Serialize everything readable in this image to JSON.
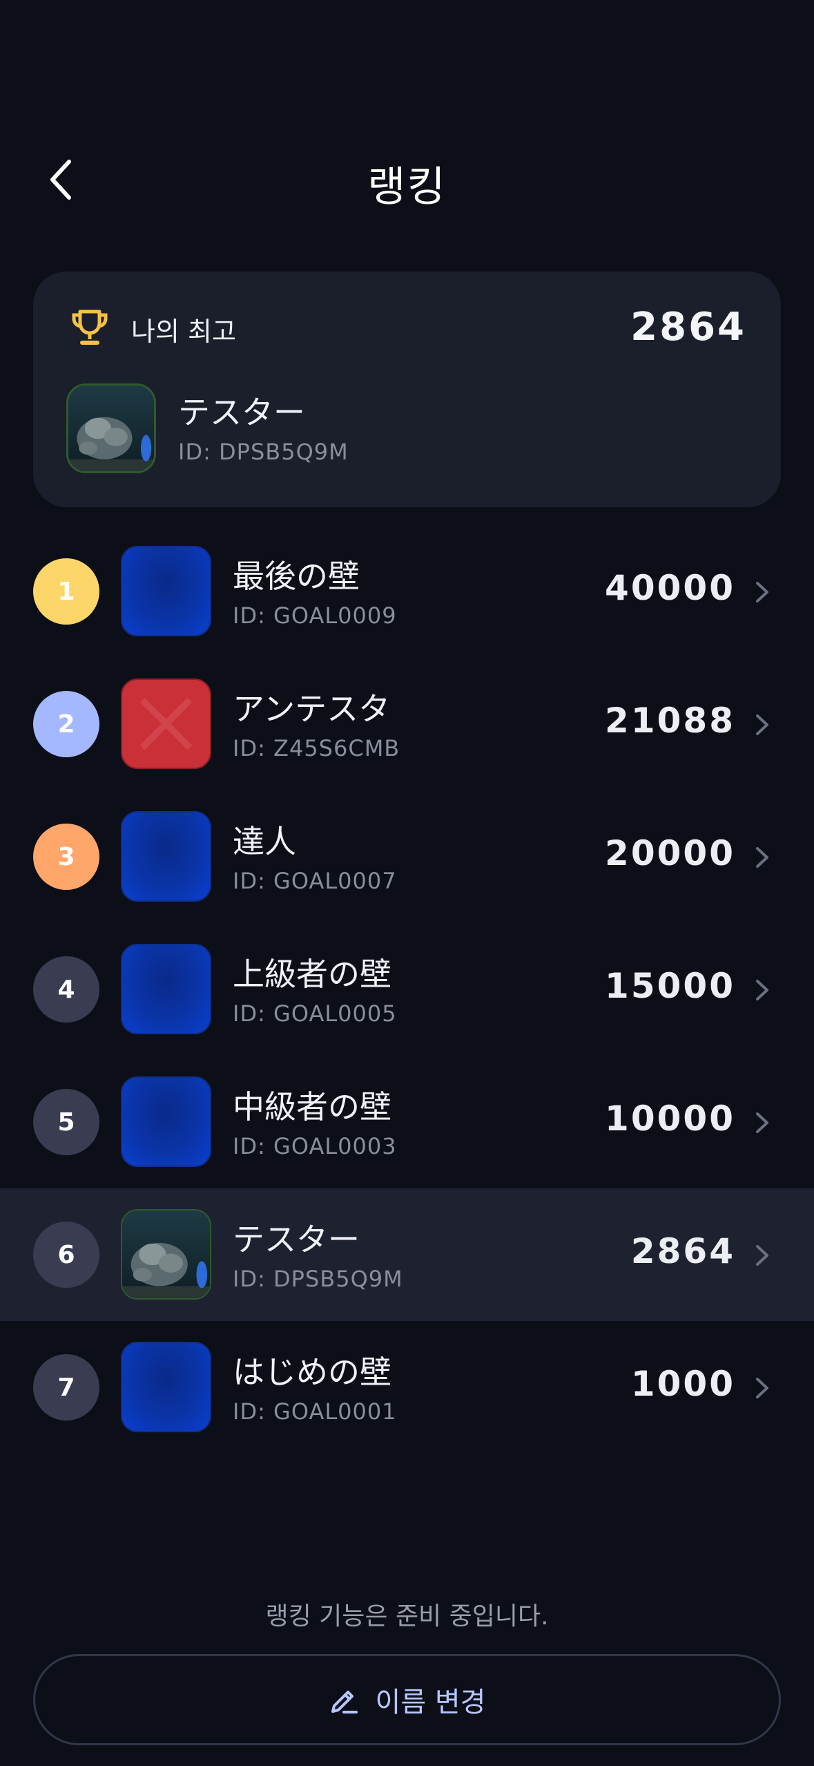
{
  "header": {
    "title": "랭킹",
    "back_icon": "chevron-left-icon"
  },
  "best": {
    "label": "나의 최고",
    "score": "2864",
    "name": "テスター",
    "id": "ID: DPSB5Q9M",
    "icon": "trophy-icon",
    "trophy_color": "#f6c246"
  },
  "rankings": [
    {
      "rank": "1",
      "name": "最後の壁",
      "id": "ID: GOAL0009",
      "score": "40000",
      "badge_color": "#fdd66a",
      "avatar": "blue"
    },
    {
      "rank": "2",
      "name": "アンテスタ",
      "id": "ID: Z45S6CMB",
      "score": "21088",
      "badge_color": "#a3b8ff",
      "avatar": "red"
    },
    {
      "rank": "3",
      "name": "達人",
      "id": "ID: GOAL0007",
      "score": "20000",
      "badge_color": "#ffa66a",
      "avatar": "blue"
    },
    {
      "rank": "4",
      "name": "上級者の壁",
      "id": "ID: GOAL0005",
      "score": "15000",
      "badge_color": "#3a3d52",
      "avatar": "blue"
    },
    {
      "rank": "5",
      "name": "中級者の壁",
      "id": "ID: GOAL0003",
      "score": "10000",
      "badge_color": "#3a3d52",
      "avatar": "blue"
    },
    {
      "rank": "6",
      "name": "テスター",
      "id": "ID: DPSB5Q9M",
      "score": "2864",
      "badge_color": "#3a3d52",
      "avatar": "photo",
      "highlighted": true
    },
    {
      "rank": "7",
      "name": "はじめの壁",
      "id": "ID: GOAL0001",
      "score": "1000",
      "badge_color": "#3a3d52",
      "avatar": "blue"
    }
  ],
  "footer": {
    "notice": "랭킹 기능은 준비 중입니다.",
    "rename_label": "이름 변경",
    "rename_icon": "pencil-icon"
  }
}
